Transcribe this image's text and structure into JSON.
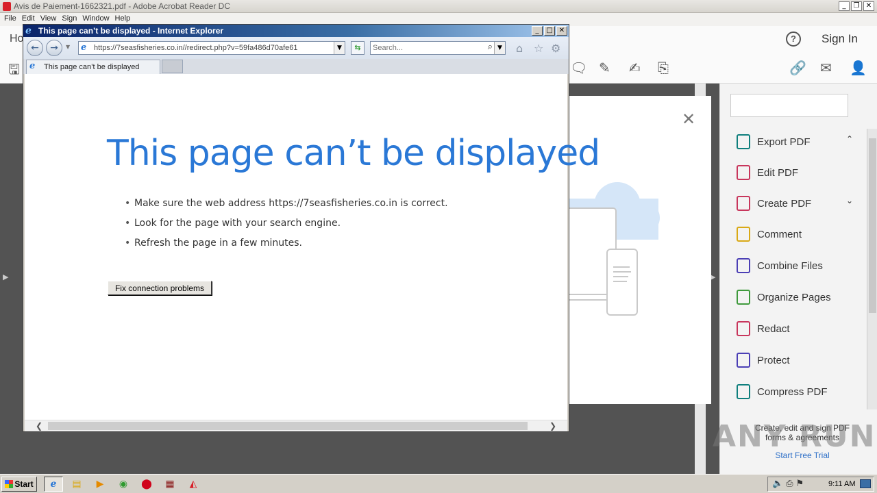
{
  "acrobat": {
    "title": "Avis de Paiement-1662321.pdf - Adobe Acrobat Reader DC",
    "menu": [
      "File",
      "Edit",
      "View",
      "Sign",
      "Window",
      "Help"
    ],
    "home_partial": "Ho",
    "sign_in": "Sign In",
    "tools": [
      {
        "label": "Export PDF",
        "icon": "export-pdf-icon",
        "color": "#0f7f7d",
        "chevron": "up"
      },
      {
        "label": "Edit PDF",
        "icon": "edit-pdf-icon",
        "color": "#c8365c"
      },
      {
        "label": "Create PDF",
        "icon": "create-pdf-icon",
        "color": "#c8365c",
        "chevron": "down"
      },
      {
        "label": "Comment",
        "icon": "comment-icon",
        "color": "#d9a916"
      },
      {
        "label": "Combine Files",
        "icon": "combine-files-icon",
        "color": "#4b3fb5"
      },
      {
        "label": "Organize Pages",
        "icon": "organize-pages-icon",
        "color": "#3f9a3c"
      },
      {
        "label": "Redact",
        "icon": "redact-icon",
        "color": "#c8365c"
      },
      {
        "label": "Protect",
        "icon": "protect-icon",
        "color": "#4b3fb5"
      },
      {
        "label": "Compress PDF",
        "icon": "compress-pdf-icon",
        "color": "#0f7f7d"
      }
    ],
    "promo_text": "Create, edit and sign PDF forms & agreements",
    "promo_link": "Start Free Trial",
    "watermark": "ANY RUN"
  },
  "ie": {
    "title": "This page can’t be displayed - Internet Explorer",
    "address": "https://7seasfisheries.co.in//redirect.php?v=59fa486d70afe61",
    "search_placeholder": "Search...",
    "tab_label": "This page can’t be displayed",
    "heading": "This page can’t be displayed",
    "bullets": [
      "Make sure the web address https://7seasfisheries.co.in is correct.",
      "Look for the page with your search engine.",
      "Refresh the page in a few minutes."
    ],
    "fix_button": "Fix connection problems",
    "accent_color": "#2a78d6"
  },
  "taskbar": {
    "start_label": "Start",
    "clock": "9:11 AM"
  }
}
